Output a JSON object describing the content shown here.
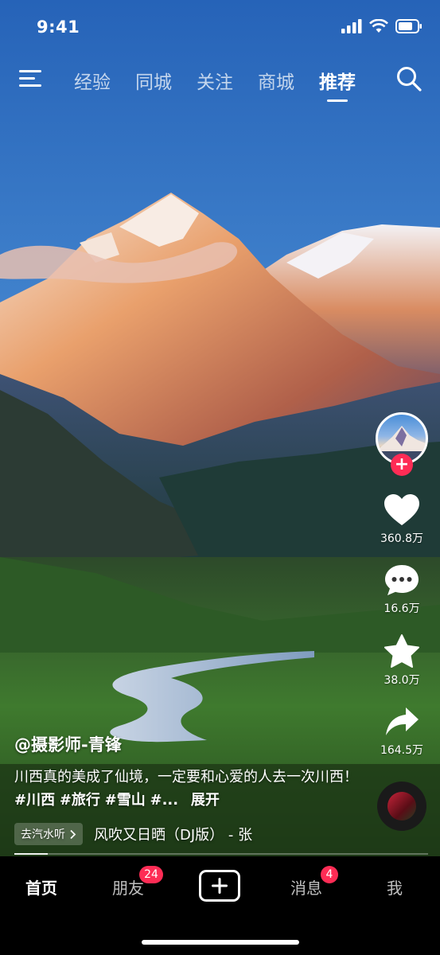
{
  "status_bar": {
    "time": "9:41"
  },
  "top_nav": {
    "tabs": [
      {
        "label": "经验",
        "active": false
      },
      {
        "label": "同城",
        "active": false
      },
      {
        "label": "关注",
        "active": false
      },
      {
        "label": "商城",
        "active": false
      },
      {
        "label": "推荐",
        "active": true
      }
    ],
    "menu_icon": "hamburger-menu-icon",
    "search_icon": "search-icon"
  },
  "actions": {
    "follow_symbol": "+",
    "likes": "360.8万",
    "comments": "16.6万",
    "favorites": "38.0万",
    "shares": "164.5万"
  },
  "caption": {
    "author": "@摄影师-青锋",
    "text": "川西真的美成了仙境，一定要和心爱的人去一次川西！",
    "tags": [
      "#川西",
      "#旅行",
      "#雪山",
      "#..."
    ],
    "more_label": "展开",
    "music_chip_label": "去汽水听",
    "music_title": "风吹又日晒（DJ版） - 张"
  },
  "progress": {
    "fraction": 0.08
  },
  "tabbar": {
    "home": "首页",
    "friends": "朋友",
    "friends_badge": "24",
    "messages": "消息",
    "messages_badge": "4",
    "me": "我"
  },
  "colors": {
    "accent": "#fe2c55",
    "tabbar_bg": "#000000",
    "sky_top": "#2a6fc2",
    "sky_bottom": "#6fa6da"
  }
}
